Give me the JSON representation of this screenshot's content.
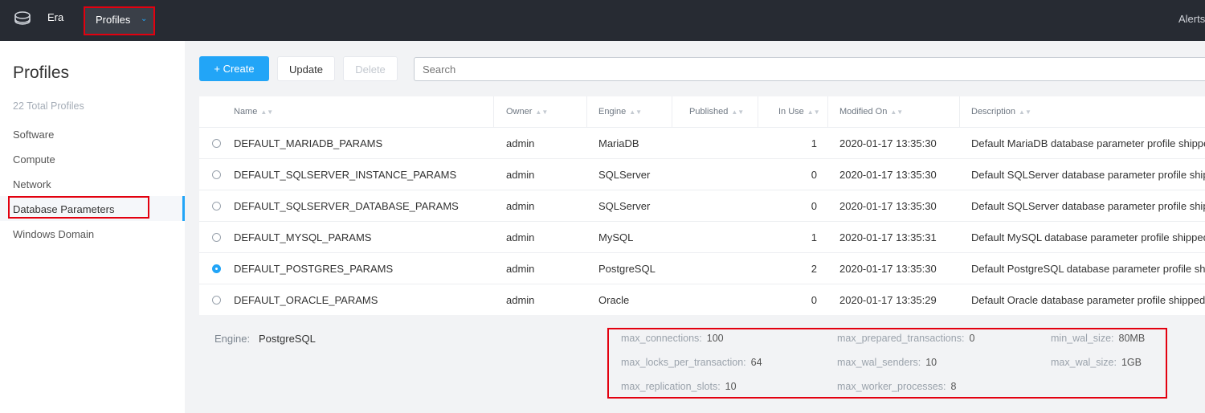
{
  "topbar": {
    "app_name": "Era",
    "menu_label": "Profiles",
    "alerts_label": "Alerts"
  },
  "sidebar": {
    "title": "Profiles",
    "count": "22 Total Profiles",
    "items": [
      "Software",
      "Compute",
      "Network",
      "Database Parameters",
      "Windows Domain"
    ]
  },
  "toolbar": {
    "create_label": "+  Create",
    "update_label": "Update",
    "delete_label": "Delete",
    "search_placeholder": "Search"
  },
  "table": {
    "headers": [
      "Name",
      "Owner",
      "Engine",
      "Published",
      "In Use",
      "Modified On",
      "Description"
    ],
    "rows": [
      {
        "name": "DEFAULT_MARIADB_PARAMS",
        "owner": "admin",
        "engine": "MariaDB",
        "published": "",
        "in_use": "1",
        "modified": "2020-01-17 13:35:30",
        "description": "Default MariaDB database parameter profile shipped"
      },
      {
        "name": "DEFAULT_SQLSERVER_INSTANCE_PARAMS",
        "owner": "admin",
        "engine": "SQLServer",
        "published": "",
        "in_use": "0",
        "modified": "2020-01-17 13:35:30",
        "description": "Default SQLServer database parameter profile shipped"
      },
      {
        "name": "DEFAULT_SQLSERVER_DATABASE_PARAMS",
        "owner": "admin",
        "engine": "SQLServer",
        "published": "",
        "in_use": "0",
        "modified": "2020-01-17 13:35:30",
        "description": "Default SQLServer database parameter profile shipped"
      },
      {
        "name": "DEFAULT_MYSQL_PARAMS",
        "owner": "admin",
        "engine": "MySQL",
        "published": "",
        "in_use": "1",
        "modified": "2020-01-17 13:35:31",
        "description": "Default MySQL database parameter profile shipped"
      },
      {
        "name": "DEFAULT_POSTGRES_PARAMS",
        "owner": "admin",
        "engine": "PostgreSQL",
        "published": "",
        "in_use": "2",
        "modified": "2020-01-17 13:35:30",
        "description": "Default PostgreSQL database parameter profile shipped",
        "selected": true
      },
      {
        "name": "DEFAULT_ORACLE_PARAMS",
        "owner": "admin",
        "engine": "Oracle",
        "published": "",
        "in_use": "0",
        "modified": "2020-01-17 13:35:29",
        "description": "Default Oracle database parameter profile shipped"
      }
    ]
  },
  "details": {
    "engine_label": "Engine:",
    "engine_value": "PostgreSQL",
    "params": [
      {
        "key": "max_connections:",
        "value": "100"
      },
      {
        "key": "max_prepared_transactions:",
        "value": "0"
      },
      {
        "key": "min_wal_size:",
        "value": "80MB"
      },
      {
        "key": "max_locks_per_transaction:",
        "value": "64"
      },
      {
        "key": "max_wal_senders:",
        "value": "10"
      },
      {
        "key": "max_wal_size:",
        "value": "1GB"
      },
      {
        "key": "max_replication_slots:",
        "value": "10"
      },
      {
        "key": "max_worker_processes:",
        "value": "8"
      }
    ]
  },
  "colors": {
    "accent": "#22a5f7",
    "topbar": "#272b33",
    "highlight": "#e3000f"
  }
}
